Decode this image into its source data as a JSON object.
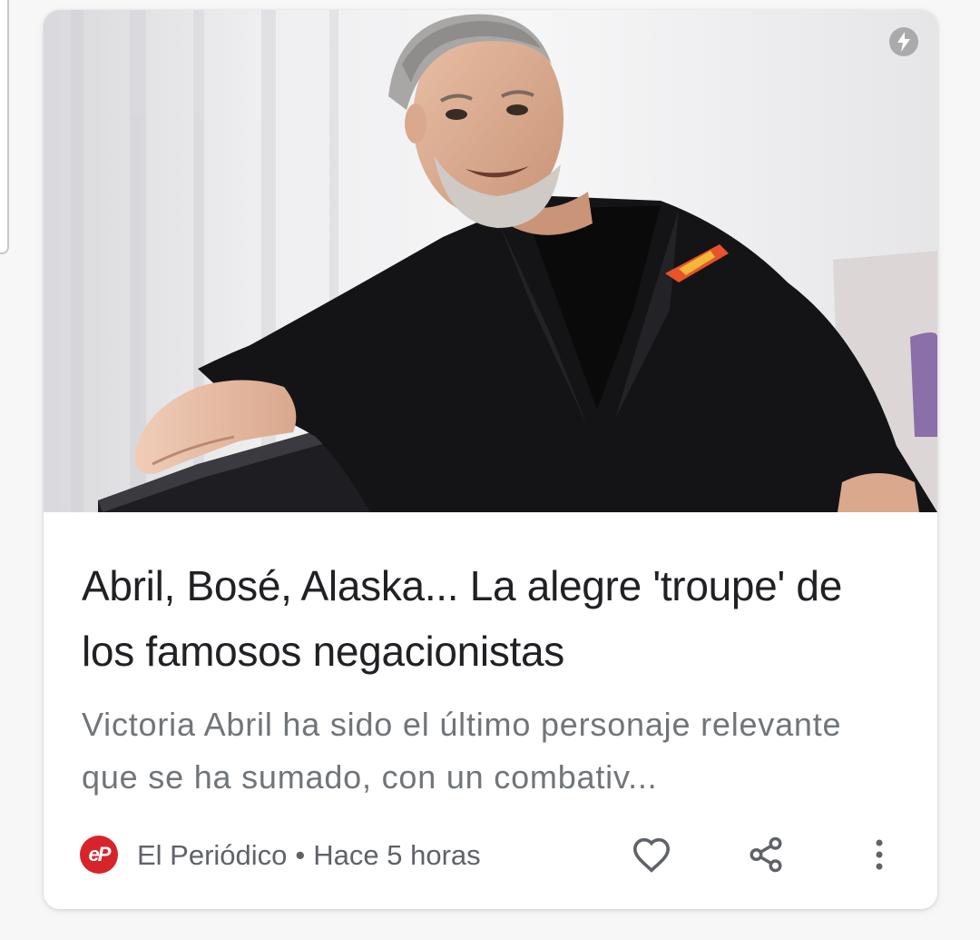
{
  "article": {
    "image_alt": "Hombre con barba canosa y traje negro sonriendo",
    "headline": "Abril, Bosé, Alaska... La alegre 'troupe' de los famosos negacionistas",
    "snippet": "Victoria Abril ha sido el último personaje relevante que se ha sumado, con un combativ...",
    "source": {
      "name": "El Periódico",
      "logo_text": "eP",
      "logo_color": "#d7242b"
    },
    "separator": "•",
    "time": "Hace 5 horas",
    "amp_icon": "lightning-bolt-icon",
    "actions": {
      "like_icon": "heart-outline-icon",
      "share_icon": "share-icon",
      "more_icon": "more-vert-icon"
    }
  },
  "colors": {
    "headline": "#202124",
    "snippet": "#70757a",
    "meta": "#5f6368",
    "card_bg": "#ffffff",
    "page_bg": "#f7f7f7"
  }
}
